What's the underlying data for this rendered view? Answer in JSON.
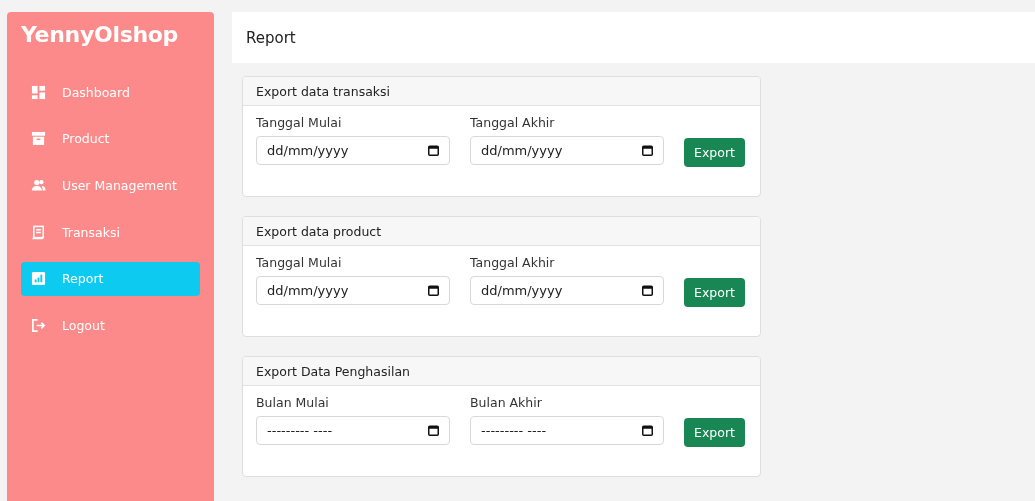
{
  "sidebar": {
    "brand": "YennyOlshop",
    "items": [
      {
        "label": "Dashboard",
        "selected": false
      },
      {
        "label": "Product",
        "selected": false
      },
      {
        "label": "User Management",
        "selected": false
      },
      {
        "label": "Transaksi",
        "selected": false
      },
      {
        "label": "Report",
        "selected": true
      },
      {
        "label": "Logout",
        "selected": false
      }
    ]
  },
  "header": {
    "title": "Report"
  },
  "cards": [
    {
      "title": "Export data transaksi",
      "fields": [
        {
          "label": "Tanggal Mulai",
          "placeholder": "dd/mm/yyyy"
        },
        {
          "label": "Tanggal Akhir",
          "placeholder": "dd/mm/yyyy"
        }
      ],
      "button": "Export"
    },
    {
      "title": "Export data product",
      "fields": [
        {
          "label": "Tanggal Mulai",
          "placeholder": "dd/mm/yyyy"
        },
        {
          "label": "Tanggal Akhir",
          "placeholder": "dd/mm/yyyy"
        }
      ],
      "button": "Export"
    },
    {
      "title": "Export Data Penghasilan",
      "fields": [
        {
          "label": "Bulan Mulai",
          "placeholder": "--------- ----"
        },
        {
          "label": "Bulan Akhir",
          "placeholder": "--------- ----"
        }
      ],
      "button": "Export"
    }
  ]
}
